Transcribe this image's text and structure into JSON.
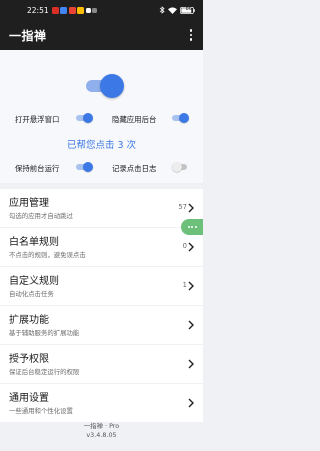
{
  "status_bar": {
    "time": "22:51",
    "notification_colors": [
      "#d93025",
      "#4285f4",
      "#ea4335",
      "#fbbc04",
      "#ffffff",
      "#888888"
    ],
    "battery": "86"
  },
  "app_bar": {
    "title": "一指禅",
    "overflow_icon": "more-vert-icon"
  },
  "hero": {
    "master_switch_on": true,
    "click_count_text": "已帮您点击 3 次",
    "options": [
      {
        "label": "打开悬浮窗口",
        "on": true
      },
      {
        "label": "隐藏应用后台",
        "on": true
      },
      {
        "label": "保持前台运行",
        "on": true
      },
      {
        "label": "记录点击日志",
        "on": false
      }
    ]
  },
  "menu": [
    {
      "title": "应用管理",
      "subtitle": "勾选的应用才自动跳过",
      "count": "57"
    },
    {
      "title": "白名单规则",
      "subtitle": "不点击的规则，避免误点击",
      "count": "0"
    },
    {
      "title": "自定义规则",
      "subtitle": "自动化点击任务",
      "count": "1"
    },
    {
      "title": "扩展功能",
      "subtitle": "基于辅助服务的扩展功能",
      "count": ""
    },
    {
      "title": "授予权限",
      "subtitle": "保证后台稳定运行的权限",
      "count": ""
    },
    {
      "title": "通用设置",
      "subtitle": "一些通用和个性化设置",
      "count": ""
    }
  ],
  "footer": {
    "app_name": "一指禅 · Pro",
    "version": "v3.4.8.05"
  },
  "colors": {
    "accent": "#3c78e6",
    "floating_badge": "#6cc07a"
  }
}
